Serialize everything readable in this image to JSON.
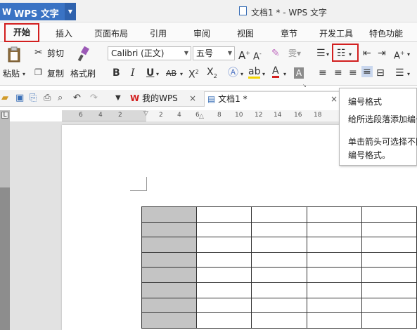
{
  "app": {
    "menu_label": "WPS 文字",
    "window_title": "文档1 * - WPS 文字"
  },
  "tabs": [
    {
      "label": "开始",
      "active": true
    },
    {
      "label": "插入"
    },
    {
      "label": "页面布局"
    },
    {
      "label": "引用"
    },
    {
      "label": "审阅"
    },
    {
      "label": "视图"
    },
    {
      "label": "章节"
    },
    {
      "label": "开发工具"
    },
    {
      "label": "特色功能"
    }
  ],
  "ribbon": {
    "paste_label": "粘贴",
    "cut_label": "剪切",
    "copy_label": "复制",
    "format_painter_label": "格式刷",
    "font_name": "Calibri (正文)",
    "font_size": "五号"
  },
  "quick_toolbar": {
    "tab_mywps": "我的WPS",
    "tab_doc": "文档1 *"
  },
  "ruler": {
    "ticks": [
      "6",
      "4",
      "2",
      "2",
      "4",
      "6",
      "8",
      "10",
      "12",
      "14",
      "16",
      "18"
    ]
  },
  "tooltip": {
    "title": "编号格式",
    "line1": "给所选段落添加编号",
    "line2": "单击箭头可选择不同的",
    "line3": "编号格式。"
  },
  "table": {
    "rows": 8,
    "cols": 5
  },
  "colors": {
    "accent": "#3a73c4",
    "highlight": "#d21f1f",
    "cell_shade": "#c4c4c4"
  }
}
